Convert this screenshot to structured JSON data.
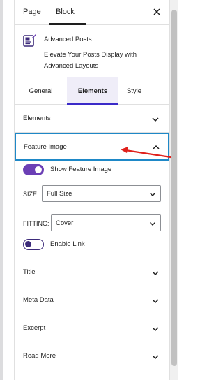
{
  "top_tabs": {
    "page": "Page",
    "block": "Block"
  },
  "block": {
    "title": "Advanced Posts",
    "description": "Elevate Your Posts Display with Advanced Layouts"
  },
  "inner_tabs": {
    "general": "General",
    "elements": "Elements",
    "style": "Style"
  },
  "sections": {
    "elements": "Elements",
    "feature_image": "Feature Image",
    "title": "Title",
    "meta_data": "Meta Data",
    "excerpt": "Excerpt",
    "read_more": "Read More"
  },
  "feature_image": {
    "show_label": "Show Feature Image",
    "show_enabled": true,
    "size_label": "SIZE:",
    "size_value": "Full Size",
    "fitting_label": "FITTING:",
    "fitting_value": "Cover",
    "link_label": "Enable Link",
    "link_enabled": false
  },
  "colors": {
    "accent": "#6b3fb5",
    "focus_border": "#1e88c7",
    "annotation_arrow": "#e0201b"
  },
  "icons": [
    "close-icon",
    "advanced-posts-icon",
    "chevron-down-icon",
    "chevron-up-icon"
  ]
}
